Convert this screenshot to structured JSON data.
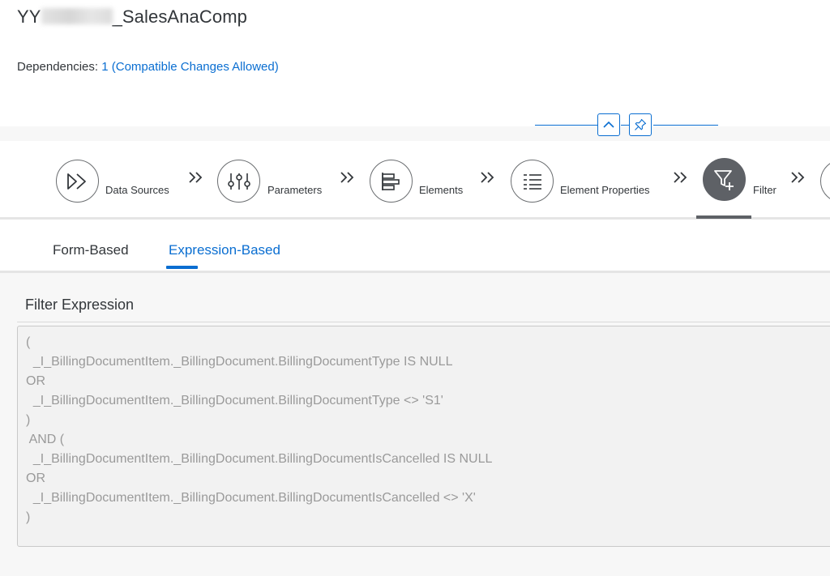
{
  "header": {
    "title_prefix": "YY",
    "title_suffix": "_SalesAnaComp",
    "dependencies_label": "Dependencies:",
    "dependencies_link": "1 (Compatible Changes Allowed)"
  },
  "wizard": {
    "steps": [
      {
        "label": "Data Sources",
        "icon": "data-sources-icon"
      },
      {
        "label": "Parameters",
        "icon": "parameters-icon"
      },
      {
        "label": "Elements",
        "icon": "elements-icon"
      },
      {
        "label": "Element Properties",
        "icon": "element-properties-icon"
      },
      {
        "label": "Filter",
        "icon": "filter-icon",
        "active": true
      }
    ]
  },
  "tabs": [
    {
      "label": "Form-Based"
    },
    {
      "label": "Expression-Based",
      "active": true
    }
  ],
  "filter": {
    "title": "Filter Expression",
    "lines": [
      "(",
      "  _I_BillingDocumentItem._BillingDocument.BillingDocumentType IS NULL",
      "OR",
      "  _I_BillingDocumentItem._BillingDocument.BillingDocumentType <> 'S1'",
      ")",
      " AND (",
      "  _I_BillingDocumentItem._BillingDocument.BillingDocumentIsCancelled IS NULL",
      "OR",
      "  _I_BillingDocumentItem._BillingDocument.BillingDocumentIsCancelled <> 'X'",
      ")"
    ]
  },
  "colors": {
    "accent": "#0a6ed1",
    "active_step": "#5e6166",
    "disabled_text": "#9a9a9a"
  }
}
